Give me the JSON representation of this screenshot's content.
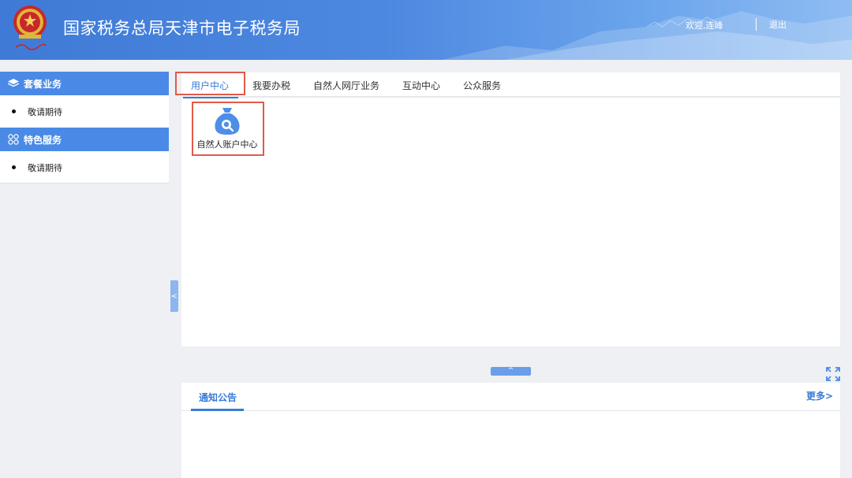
{
  "header": {
    "site_title": "国家税务总局天津市电子税务局",
    "welcome_text": "欢迎,连峰",
    "logout_label": "退出",
    "emblem_icon": "national-emblem-icon",
    "colors": {
      "header_start": "#3f7ad6",
      "header_end": "#8fbcf2"
    }
  },
  "sidebar": {
    "groups": [
      {
        "title": "套餐业务",
        "icon": "layers-icon",
        "items": [
          {
            "label": "敬请期待"
          }
        ]
      },
      {
        "title": "特色服务",
        "icon": "grid-flower-icon",
        "items": [
          {
            "label": "敬请期待"
          }
        ]
      }
    ],
    "collapse_glyph": "<"
  },
  "main": {
    "tabs": [
      {
        "label": "用户中心",
        "active": true
      },
      {
        "label": "我要办税",
        "active": false
      },
      {
        "label": "自然人网厅业务",
        "active": false
      },
      {
        "label": "互动中心",
        "active": false
      },
      {
        "label": "公众服务",
        "active": false
      }
    ],
    "tiles": [
      {
        "label": "自然人账户中心",
        "icon": "money-bag-search-icon"
      }
    ],
    "expand_glyph": "^"
  },
  "notices": {
    "title": "通知公告",
    "more_label": "更多>"
  },
  "colors": {
    "accent": "#3a7bd5",
    "sidebar_head": "#4a8ae6",
    "highlight_box": "#e05a4a"
  }
}
